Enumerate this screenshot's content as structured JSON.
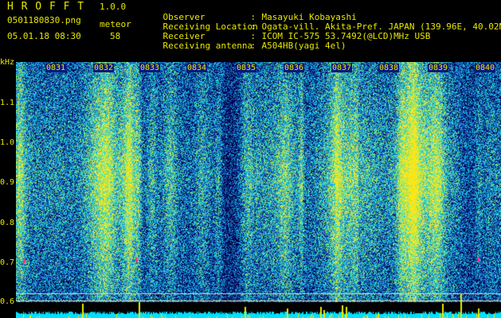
{
  "header": {
    "app_name": "H R O F F T",
    "version": "1.0.0",
    "filename": "0501180830.png",
    "datetime": "05.01.18 08:30",
    "meteor_label": "meteor",
    "meteor_count": "58"
  },
  "station": {
    "observer_label": "Observer",
    "observer_value": "Masayuki Kobayashi",
    "location_label": "Receiving Location",
    "location_value": "Ogata-vill. Akita-Pref. JAPAN (139.96E, 40.02N)",
    "receiver_label": "Receiver",
    "receiver_value": "ICOM IC-575 53.7492(@LCD)MHz USB",
    "antenna_label": "Receiving antenna",
    "antenna_value": "A504HB(yagi 4el)",
    "separator": ":"
  },
  "axis": {
    "y_unit": "kHz",
    "y_ticks": [
      "1.1",
      "1.0",
      "0.9",
      "0.8",
      "0.7",
      "0.6"
    ],
    "x_ticks": [
      "0831",
      "0832",
      "0833",
      "0834",
      "0835",
      "0836",
      "0837",
      "0838",
      "0839",
      "0840"
    ]
  },
  "colors": {
    "label_yellow": "#e8e800",
    "background": "#000000",
    "signal_cyan": "#00e0ff"
  }
}
